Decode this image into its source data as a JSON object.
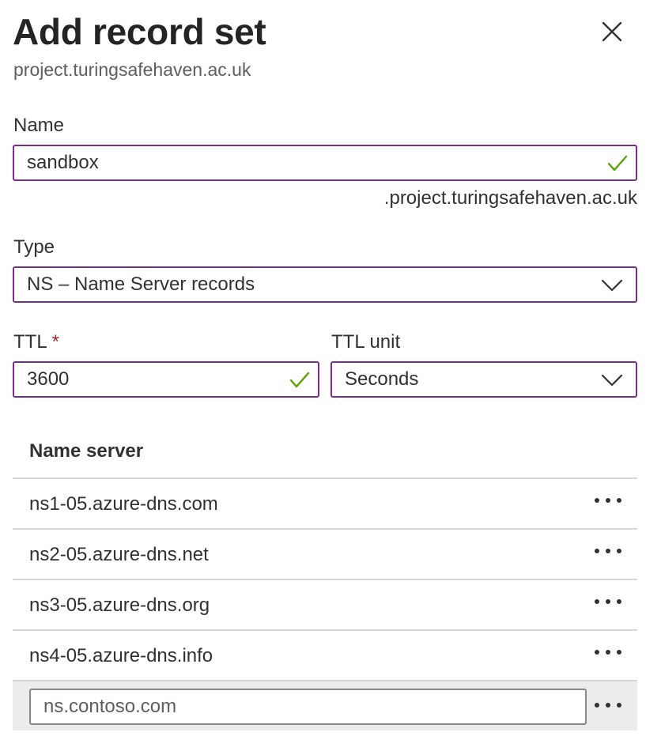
{
  "header": {
    "title": "Add record set",
    "subtitle": "project.turingsafehaven.ac.uk",
    "close_icon": "close-icon"
  },
  "form": {
    "name": {
      "label": "Name",
      "value": "sandbox",
      "valid_icon": "checkmark-icon",
      "suffix": ".project.turingsafehaven.ac.uk"
    },
    "type": {
      "label": "Type",
      "selected": "NS – Name Server records"
    },
    "ttl": {
      "label": "TTL",
      "required_marker": "*",
      "value": "3600"
    },
    "ttl_unit": {
      "label": "TTL unit",
      "selected": "Seconds"
    }
  },
  "name_servers": {
    "header": "Name server",
    "rows": [
      "ns1-05.azure-dns.com",
      "ns2-05.azure-dns.net",
      "ns3-05.azure-dns.org",
      "ns4-05.azure-dns.info"
    ],
    "new_entry_placeholder": "ns.contoso.com",
    "more_icon": "more-options-icon"
  },
  "colors": {
    "focus_border": "#7a2e8c",
    "valid_check": "#57a300",
    "required": "#a4262c",
    "row_highlight": "#ececec"
  }
}
